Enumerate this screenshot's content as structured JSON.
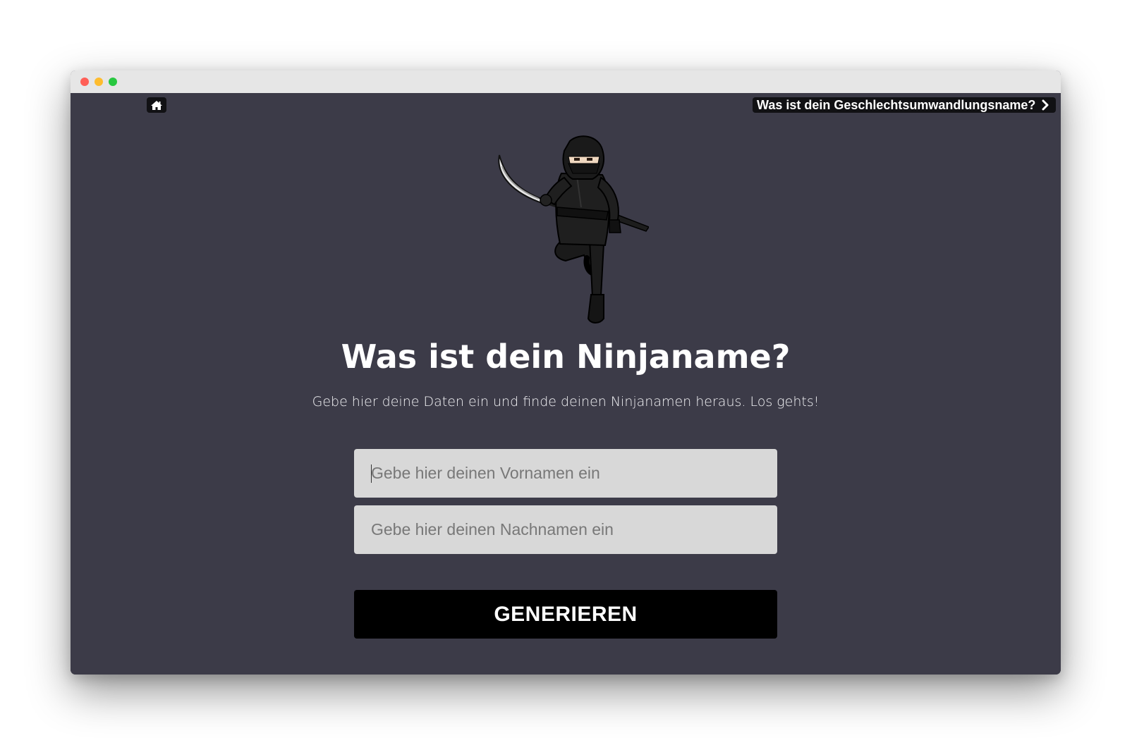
{
  "window": {
    "traffic_lights": [
      "close",
      "minimize",
      "maximize"
    ]
  },
  "nav": {
    "home_icon": "home-icon",
    "next_link_label": "Was ist dein Geschlechtsumwandlungsname?",
    "next_link_icon": "chevron-right-icon"
  },
  "hero": {
    "illustration": "ninja-illustration",
    "title": "Was ist dein Ninjaname?",
    "subtitle": "Gebe hier deine Daten ein und finde deinen Ninjanamen heraus. Los gehts!"
  },
  "form": {
    "first_name": {
      "value": "",
      "placeholder": "Gebe hier deinen Vornamen ein"
    },
    "last_name": {
      "value": "",
      "placeholder": "Gebe hier deinen Nachnamen ein"
    },
    "submit_label": "GENERIEREN"
  },
  "colors": {
    "page_background": "#3c3b48",
    "input_background": "#d8d8d8",
    "button_background": "#000000",
    "text": "#ffffff"
  }
}
